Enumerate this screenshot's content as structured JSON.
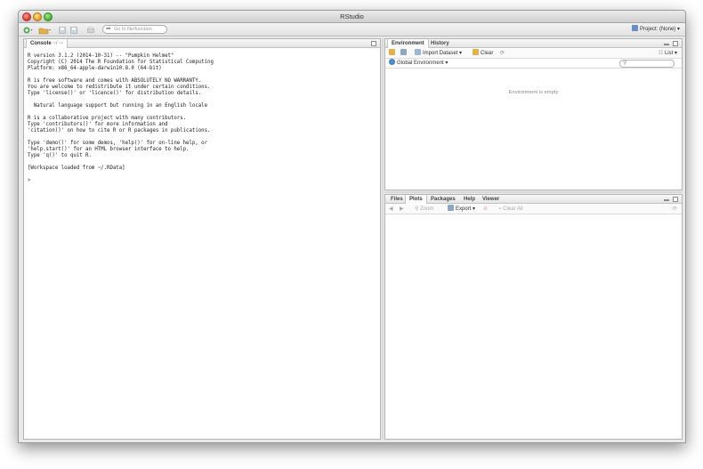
{
  "window": {
    "title": "RStudio"
  },
  "toolbar": {
    "goto_placeholder": "Go to file/function",
    "project_label": "Project: (None)"
  },
  "console": {
    "tab_label": "Console",
    "path": "~/",
    "lines": [
      "R version 3.1.2 (2014-10-31) -- \"Pumpkin Helmet\"",
      "Copyright (C) 2014 The R Foundation for Statistical Computing",
      "Platform: x86_64-apple-darwin10.8.0 (64-bit)",
      "",
      "R is free software and comes with ABSOLUTELY NO WARRANTY.",
      "You are welcome to redistribute it under certain conditions.",
      "Type 'license()' or 'licence()' for distribution details.",
      "",
      "  Natural language support but running in an English locale",
      "",
      "R is a collaborative project with many contributors.",
      "Type 'contributors()' for more information and",
      "'citation()' on how to cite R or R packages in publications.",
      "",
      "Type 'demo()' for some demos, 'help()' for on-line help, or",
      "'help.start()' for an HTML browser interface to help.",
      "Type 'q()' to quit R.",
      "",
      "[Workspace loaded from ~/.RData]",
      ""
    ],
    "prompt": ">"
  },
  "env_pane": {
    "tabs": [
      "Environment",
      "History"
    ],
    "import_label": "Import Dataset",
    "clear_label": "Clear",
    "list_label": "List",
    "scope_label": "Global Environment",
    "empty_message": "Environment is empty"
  },
  "files_pane": {
    "tabs": [
      "Files",
      "Plots",
      "Packages",
      "Help",
      "Viewer"
    ],
    "zoom_label": "Zoom",
    "export_label": "Export",
    "clear_all_label": "Clear All"
  },
  "colors": {
    "accent": "#1f4aa0",
    "window_bg": "#e9e9e9"
  }
}
